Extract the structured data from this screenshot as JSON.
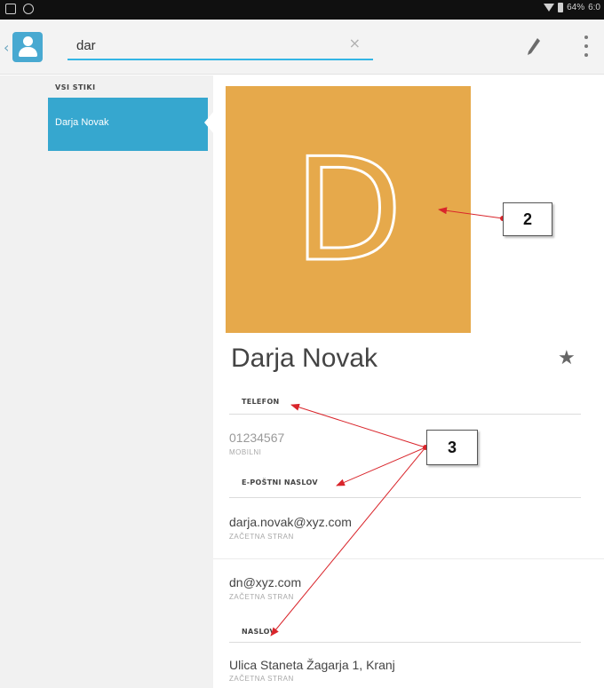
{
  "status_bar": {
    "battery": "64%",
    "time": "6:0"
  },
  "search": {
    "value": "dar",
    "clear_glyph": "×"
  },
  "list": {
    "header": "VSI STIKI",
    "selected_contact": "Darja Novak"
  },
  "contact": {
    "initial": "D",
    "name": "Darja Novak",
    "star_glyph": "★",
    "sections": {
      "phone_header": "TELEFON",
      "email_header": "E-POŠTNI NASLOV",
      "address_header": "NASLOV"
    },
    "phone": {
      "value": "01234567",
      "type": "MOBILNI"
    },
    "emails": [
      {
        "value": "darja.novak@xyz.com",
        "type": "ZAČETNA STRAN"
      },
      {
        "value": "dn@xyz.com",
        "type": "ZAČETNA STRAN"
      }
    ],
    "address": {
      "value": "Ulica Staneta Žagarja 1, Kranj",
      "type": "ZAČETNA STRAN"
    }
  },
  "annotations": {
    "callout_2": "2",
    "callout_3": "3"
  },
  "colors": {
    "accent": "#33b5e5",
    "selected_item": "#36a7cf",
    "photo_bg": "#e6a94b",
    "annotation_arrow": "#d9252b"
  },
  "icons": {
    "back": "chevron-left-icon",
    "app": "contacts-app-icon",
    "clear": "close-icon",
    "edit": "pencil-icon",
    "overflow": "more-vert-icon",
    "favorite": "star-icon"
  }
}
